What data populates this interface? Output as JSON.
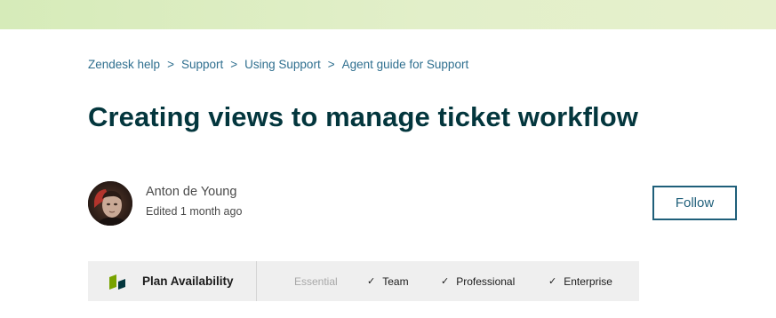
{
  "breadcrumb": {
    "items": [
      "Zendesk help",
      "Support",
      "Using Support",
      "Agent guide for Support"
    ],
    "separator": ">"
  },
  "article": {
    "title": "Creating views to manage ticket workflow"
  },
  "author": {
    "name": "Anton de Young",
    "edited": "Edited 1 month ago"
  },
  "follow": {
    "label": "Follow"
  },
  "plan": {
    "label": "Plan Availability",
    "tiers": [
      {
        "name": "Essential",
        "available": false
      },
      {
        "name": "Team",
        "available": true
      },
      {
        "name": "Professional",
        "available": true
      },
      {
        "name": "Enterprise",
        "available": true
      }
    ],
    "check_glyph": "✓"
  },
  "colors": {
    "link": "#2f6f8f",
    "title": "#03363d",
    "top_band": "#e2efc9",
    "plan_bar": "#efefef",
    "follow_border": "#1f5f7a",
    "icon_green": "#78a300"
  }
}
